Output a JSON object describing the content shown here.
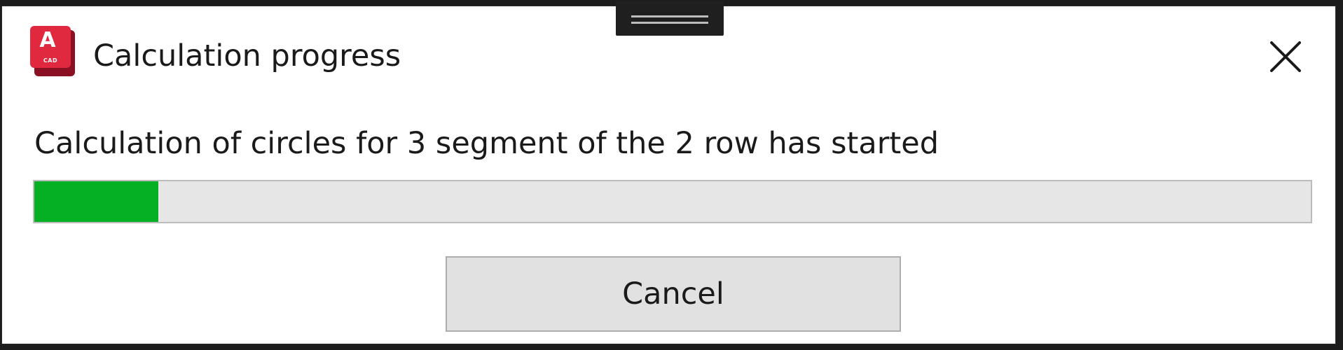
{
  "window": {
    "title": "Calculation progress",
    "app_icon": {
      "name": "autocad-icon",
      "letter": "A",
      "sub_label": "CAD",
      "color": "#e0283f"
    },
    "close_icon": "close-icon"
  },
  "progress": {
    "message": "Calculation of circles for 3 segment of the 2 row has started",
    "fraction": 0.097,
    "fill_color": "#06b025",
    "track_color": "#e6e6e6"
  },
  "buttons": {
    "cancel_label": "Cancel"
  }
}
